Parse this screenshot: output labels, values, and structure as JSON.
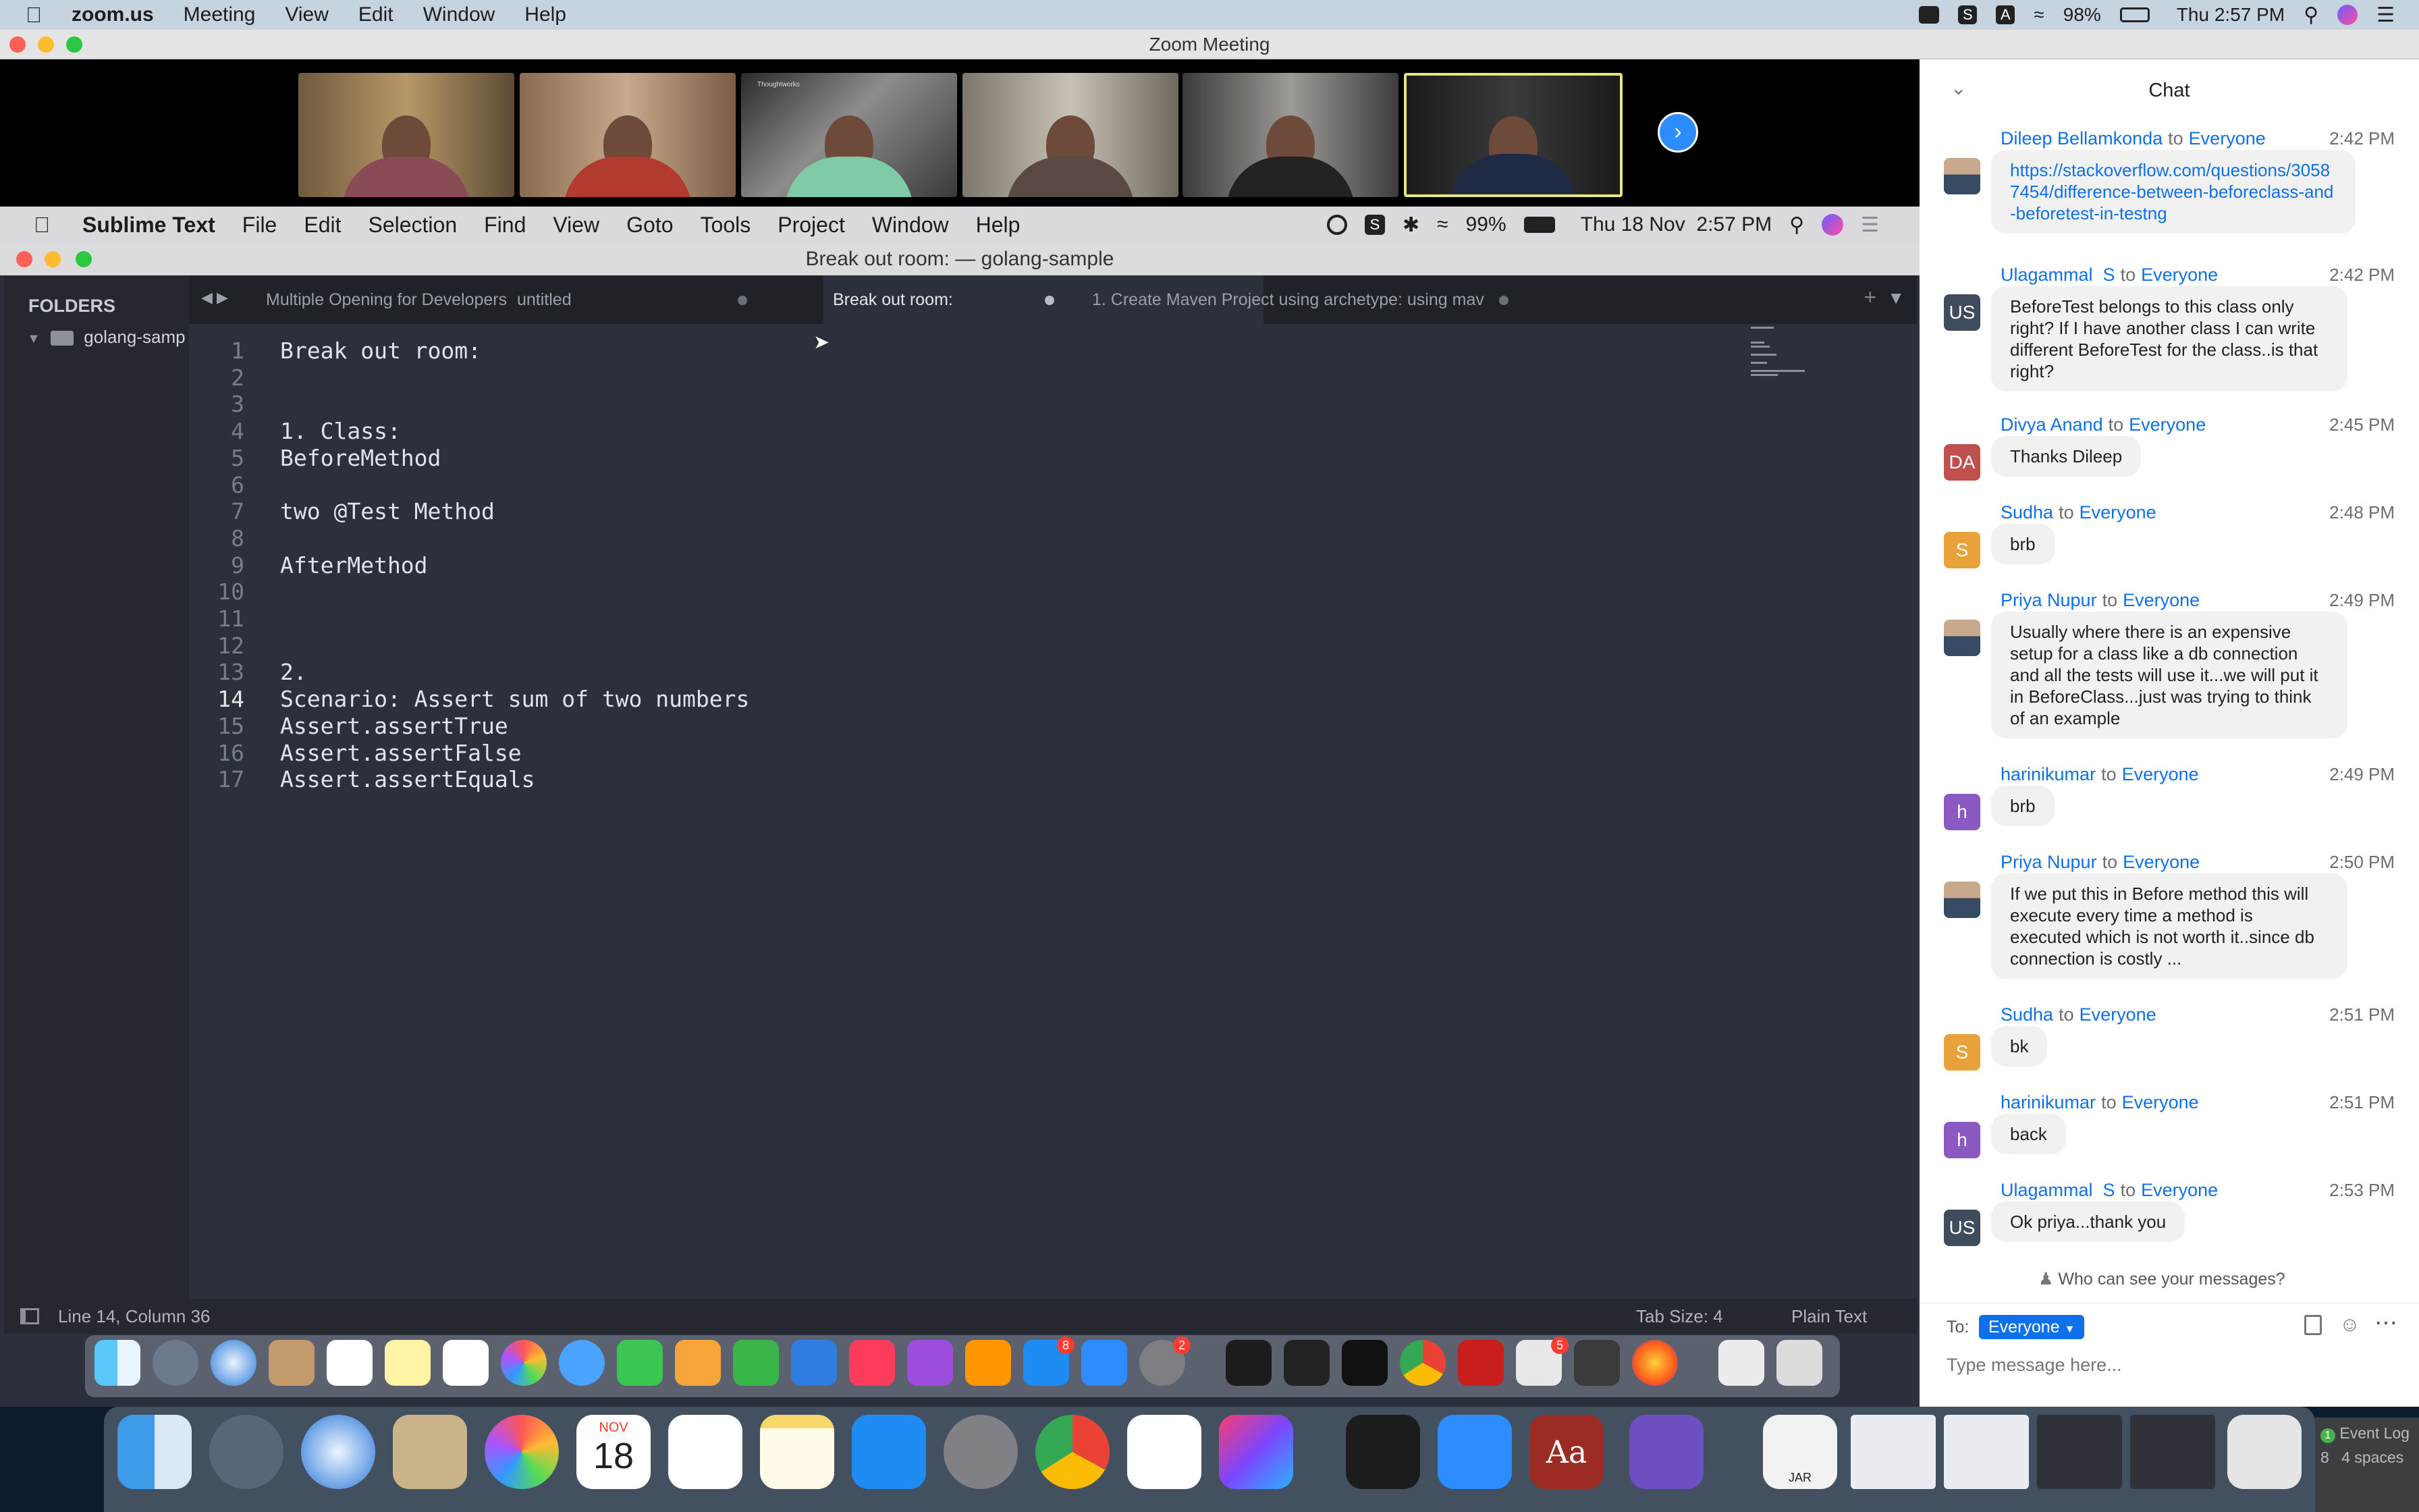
{
  "menubar": {
    "app": "zoom.us",
    "items": [
      "Meeting",
      "View",
      "Edit",
      "Window",
      "Help"
    ],
    "battery": "98%",
    "clock": "Thu 2:57 PM"
  },
  "zoom": {
    "window_title": "Zoom Meeting",
    "thumbnail_label": "Thoughtworks"
  },
  "shared": {
    "menubar": {
      "app": "Sublime Text",
      "items": [
        "File",
        "Edit",
        "Selection",
        "Find",
        "View",
        "Goto",
        "Tools",
        "Project",
        "Window",
        "Help"
      ],
      "battery": "99%",
      "clock": "Thu 18 Nov  2:57 PM"
    },
    "window_title": "Break out room: — golang-sample",
    "sidebar": {
      "header": "FOLDERS",
      "folder": "golang-samp"
    },
    "tabs": [
      {
        "label": "Multiple Opening for Developers"
      },
      {
        "label": "untitled"
      },
      {
        "label": "Break out room:"
      },
      {
        "label": "1. Create Maven Project using archetype: using mav"
      }
    ],
    "lines": [
      {
        "n": "1",
        "text": "Break out room:"
      },
      {
        "n": "2",
        "text": ""
      },
      {
        "n": "3",
        "text": ""
      },
      {
        "n": "4",
        "text": "1. Class:"
      },
      {
        "n": "5",
        "text": "BeforeMethod"
      },
      {
        "n": "6",
        "text": ""
      },
      {
        "n": "7",
        "text": "two @Test Method"
      },
      {
        "n": "8",
        "text": ""
      },
      {
        "n": "9",
        "text": "AfterMethod"
      },
      {
        "n": "10",
        "text": ""
      },
      {
        "n": "11",
        "text": ""
      },
      {
        "n": "12",
        "text": ""
      },
      {
        "n": "13",
        "text": "2."
      },
      {
        "n": "14",
        "text": "Scenario: Assert sum of two numbers"
      },
      {
        "n": "15",
        "text": "Assert.assertTrue"
      },
      {
        "n": "16",
        "text": "Assert.assertFalse"
      },
      {
        "n": "17",
        "text": "Assert.assertEquals"
      }
    ],
    "status": {
      "position": "Line 14, Column 36",
      "tab_size": "Tab Size: 4",
      "syntax": "Plain Text"
    },
    "dock_badges": {
      "slack": "8",
      "settings": "2",
      "office": "5"
    }
  },
  "chat": {
    "title": "Chat",
    "messages": [
      {
        "sender": "Dileep Bellamkonda",
        "to": "to",
        "recipient": "Everyone",
        "time": "2:42 PM",
        "initials": "",
        "text": "https://stackoverflow.com/questions/30587454/difference-between-beforeclass-and-beforetest-in-testng"
      },
      {
        "sender": "Ulagammal  S",
        "to": "to",
        "recipient": "Everyone",
        "time": "2:42 PM",
        "initials": "US",
        "text": "BeforeTest belongs to this class only right? If I have another class I can write different BeforeTest for the class..is that right?"
      },
      {
        "sender": "Divya Anand",
        "to": "to",
        "recipient": "Everyone",
        "time": "2:45 PM",
        "initials": "DA",
        "text": "Thanks Dileep"
      },
      {
        "sender": "Sudha",
        "to": "to",
        "recipient": "Everyone",
        "time": "2:48 PM",
        "initials": "S",
        "text": "brb"
      },
      {
        "sender": "Priya Nupur",
        "to": "to",
        "recipient": "Everyone",
        "time": "2:49 PM",
        "initials": "",
        "text": "Usually where there is an expensive setup for a class like a db connection and all the tests will use it...we will put it in BeforeClass...just was trying to think of an example"
      },
      {
        "sender": "harinikumar",
        "to": "to",
        "recipient": "Everyone",
        "time": "2:49 PM",
        "initials": "h",
        "text": "brb"
      },
      {
        "sender": "Priya Nupur",
        "to": "to",
        "recipient": "Everyone",
        "time": "2:50 PM",
        "initials": "",
        "text": "If we put this in Before method this will execute every time a method is executed which is not worth it..since db connection is costly ..."
      },
      {
        "sender": "Sudha",
        "to": "to",
        "recipient": "Everyone",
        "time": "2:51 PM",
        "initials": "S",
        "text": "bk"
      },
      {
        "sender": "harinikumar",
        "to": "to",
        "recipient": "Everyone",
        "time": "2:51 PM",
        "initials": "h",
        "text": "back"
      },
      {
        "sender": "Ulagammal  S",
        "to": "to",
        "recipient": "Everyone",
        "time": "2:53 PM",
        "initials": "US",
        "text": "Ok priya...thank you"
      }
    ],
    "who_can_see": "Who can see your messages?",
    "to_label": "To:",
    "to_value": "Everyone",
    "input_placeholder": "Type message here..."
  },
  "dock": {
    "calendar_month": "NOV",
    "calendar_day": "18",
    "jar_label": "JAR",
    "dictionary_glyph": "Aa"
  },
  "ide_fragment": {
    "event_log_count": "1",
    "event_log": "Event Log",
    "line_ending_frag": "8",
    "indent": "4 spaces"
  }
}
